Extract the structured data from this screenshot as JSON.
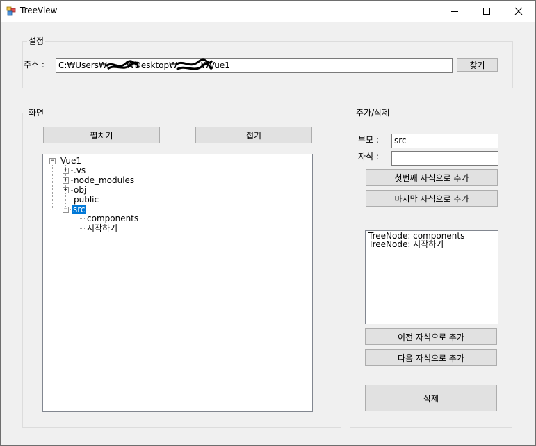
{
  "window": {
    "title": "TreeView"
  },
  "settings": {
    "group_label": "설정",
    "address_label": "주소 :",
    "address_value": "C:₩Users₩",
    "address_part2": "₩Desktop₩",
    "address_part3": "₩Vue1",
    "find_button": "찾기"
  },
  "screen": {
    "group_label": "화면",
    "expand_button": "펼치기",
    "collapse_button": "접기",
    "tree": {
      "root": "Vue1",
      "children": [
        ".vs",
        "node_modules",
        "obj",
        "public",
        "src"
      ],
      "src_children": [
        "components",
        "시작하기"
      ]
    }
  },
  "edit": {
    "group_label": "추가/삭제",
    "parent_label": "부모 :",
    "parent_value": "src",
    "child_label": "자식 :",
    "child_value": "",
    "add_first_button": "첫번째 자식으로 추가",
    "add_last_button": "마지막 자식으로 추가",
    "list_items": [
      "TreeNode: components",
      "TreeNode: 시작하기"
    ],
    "add_prev_button": "이전 자식으로 추가",
    "add_next_button": "다음 자식으로 추가",
    "delete_button": "삭제"
  }
}
